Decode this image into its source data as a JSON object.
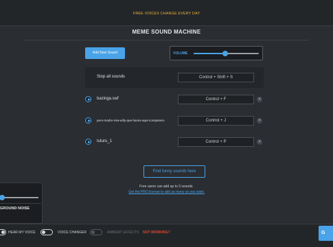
{
  "banner": {
    "promo": "FREE VOICES CHANGE EVERY DAY"
  },
  "title": "MEME SOUND MACHINE",
  "toolbar": {
    "add_label": "Add New Sound"
  },
  "volume": {
    "label": "VOLUME",
    "level_percent": 48
  },
  "stop_all": {
    "label": "Stop all sounds",
    "shortcut": "Control + Shift + S"
  },
  "sounds": [
    {
      "name": "bazinga.swf",
      "shortcut": "Control + F",
      "remove": "×"
    },
    {
      "name": "pero-madre-mia-willy-que-haces-aqui-companero",
      "shortcut": "Control + J",
      "remove": "×"
    },
    {
      "name": "tuturu_1",
      "shortcut": "Control + P",
      "remove": "×"
    }
  ],
  "find_label": "Find funny sounds here",
  "notes": {
    "free_limit": "Free users can add up to 3 sounds.",
    "pro_link": "Get the PRO license to add as many as you want."
  },
  "background_noise": {
    "label": "GROUND NOISE",
    "level_percent": 5
  },
  "bottom": {
    "hear_my_voice": "HEAR MY VOICE",
    "voice_changer": "VOICE CHANGER",
    "ambient_effects": "AMBIENT EFFECTS",
    "status": "NOT WORKING?",
    "go_label": "G"
  },
  "colors": {
    "accent": "#4aa3e8",
    "promo": "#e8b23a",
    "warning": "#e0472f"
  }
}
